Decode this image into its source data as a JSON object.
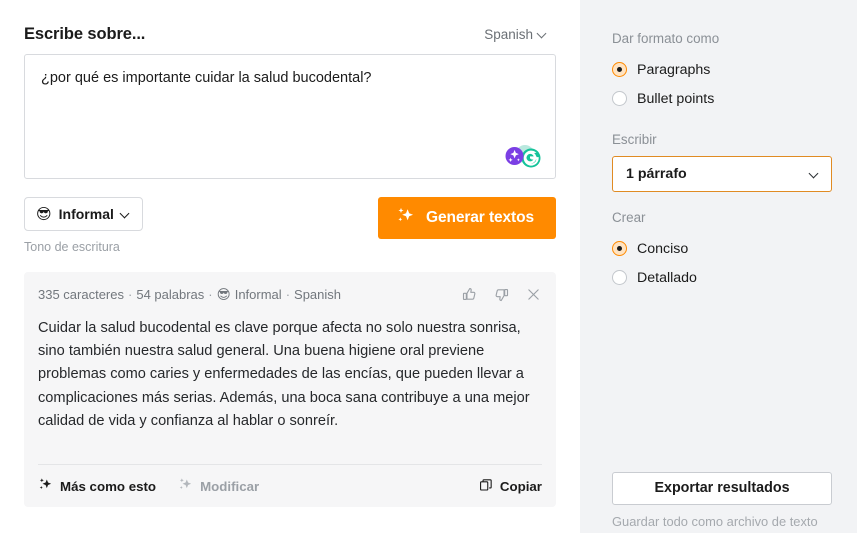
{
  "header": {
    "title": "Escribe sobre...",
    "language": "Spanish",
    "language_chevron_icon": "chevron-down-icon"
  },
  "prompt": {
    "value": "¿por qué es importante cuidar la salud bucodental?",
    "placeholder": "Escribe sobre...",
    "brand_icon": "grammarly-logo-icon"
  },
  "controls": {
    "tone_emoji": "😎",
    "tone_label": "Informal",
    "tone_chevron_icon": "chevron-down-icon",
    "tone_caption": "Tono de escritura",
    "generate_icon": "sparkles-icon",
    "generate_label": "Generar textos"
  },
  "result": {
    "char_count": "335 caracteres",
    "word_count": "54 palabras",
    "tone_emoji": "😎",
    "tone": "Informal",
    "language": "Spanish",
    "separator": "·",
    "thumbs_up_icon": "thumbs-up-icon",
    "thumbs_down_icon": "thumbs-down-icon",
    "close_icon": "close-icon",
    "text": "Cuidar la salud bucodental es clave porque afecta no solo nuestra sonrisa, sino también nuestra salud general. Una buena higiene oral previene problemas como caries y enfermedades de las encías, que pueden llevar a complicaciones más serias. Además, una boca sana contribuye a una mejor calidad de vida y confianza al hablar o sonreír.",
    "more_like_this_icon": "sparkles-icon",
    "more_like_this_label": "Más como esto",
    "modify_icon": "sparkles-icon",
    "modify_label": "Modificar",
    "copy_icon": "copy-icon",
    "copy_label": "Copiar"
  },
  "sidebar": {
    "format_label": "Dar formato como",
    "format_options": [
      {
        "label": "Paragraphs",
        "selected": true
      },
      {
        "label": "Bullet points",
        "selected": false
      }
    ],
    "write_label": "Escribir",
    "write_value": "1 párrafo",
    "write_chevron_icon": "chevron-down-icon",
    "create_label": "Crear",
    "create_options": [
      {
        "label": "Conciso",
        "selected": true
      },
      {
        "label": "Detallado",
        "selected": false
      }
    ],
    "export_label": "Exportar resultados",
    "export_caption": "Guardar todo como archivo de texto"
  },
  "colors": {
    "accent": "#ff8a00",
    "select_border": "#e08b23",
    "sidebar_bg": "#f2f3f5",
    "card_bg": "#f6f6f7",
    "text": "#1b1b1b",
    "muted": "#9ba0a6"
  }
}
